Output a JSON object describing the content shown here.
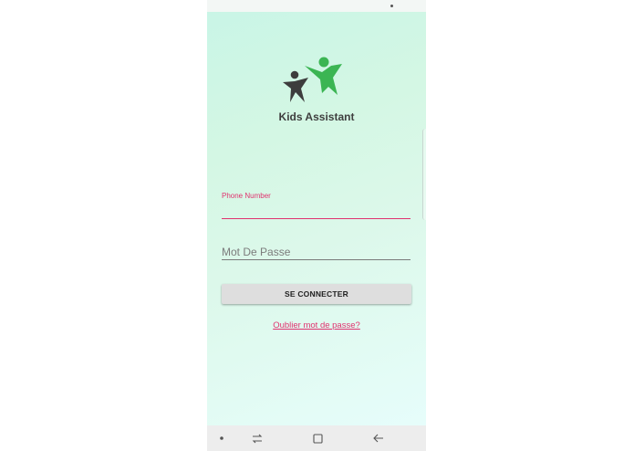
{
  "app": {
    "title": "Kids Assistant"
  },
  "form": {
    "phone_label": "Phone Number",
    "phone_value": "",
    "password_placeholder": "Mot De Passe",
    "password_value": "",
    "connect_label": "SE CONNECTER",
    "forgot_label": "Oublier mot de passe?"
  },
  "nav": {
    "icons": [
      "dot-icon",
      "recent-apps-icon",
      "home-icon",
      "back-icon"
    ]
  },
  "colors": {
    "accent": "#e0326e",
    "logo_green": "#3bb553",
    "logo_dark": "#3d3d3d",
    "button_bg": "#dedede"
  }
}
